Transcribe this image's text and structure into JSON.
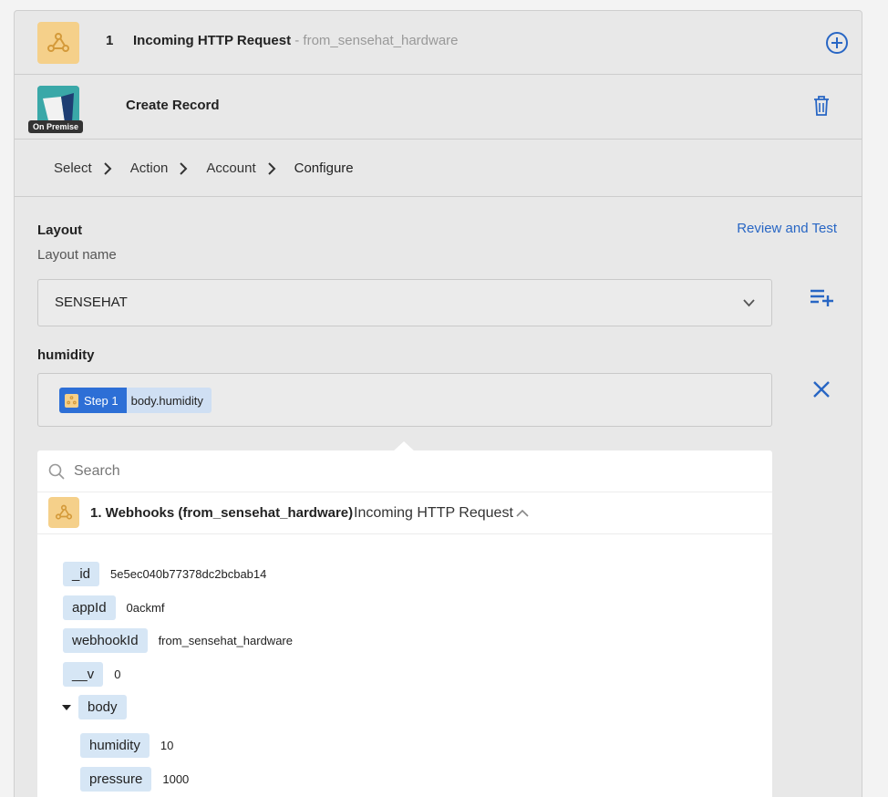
{
  "step1": {
    "number": "1",
    "title": "Incoming HTTP Request",
    "subtitle": "- from_sensehat_hardware"
  },
  "step2": {
    "title": "Create Record",
    "badge": "On Premise"
  },
  "breadcrumb": [
    "Select",
    "Action",
    "Account",
    "Configure"
  ],
  "layout": {
    "label": "Layout",
    "hint": "Layout name",
    "value": "SENSEHAT",
    "review_link": "Review and Test"
  },
  "humidity": {
    "label": "humidity",
    "pill_step": "Step 1",
    "pill_path": "body.humidity"
  },
  "picker": {
    "search_placeholder": "Search",
    "source_name": "1. Webhooks (from_sensehat_hardware)",
    "source_type": "Incoming HTTP Request",
    "fields": [
      {
        "key": "_id",
        "value": "5e5ec040b77378dc2bcbab14"
      },
      {
        "key": "appId",
        "value": "0ackmf"
      },
      {
        "key": "webhookId",
        "value": "from_sensehat_hardware"
      },
      {
        "key": "__v",
        "value": "0"
      },
      {
        "key": "body",
        "value": ""
      },
      {
        "key": "humidity",
        "value": "10"
      },
      {
        "key": "pressure",
        "value": "1000"
      }
    ]
  },
  "colors": {
    "accent": "#2866c4",
    "webhook_tile": "#f5d08a",
    "pill_step": "#2d6fd6",
    "key_bg": "#d6e6f5"
  },
  "icons": {
    "webhook": "webhook-icon",
    "add": "plus-circle-icon",
    "trash": "trash-icon",
    "list_add": "playlist-add-icon",
    "clear": "close-icon",
    "search": "search-icon"
  }
}
